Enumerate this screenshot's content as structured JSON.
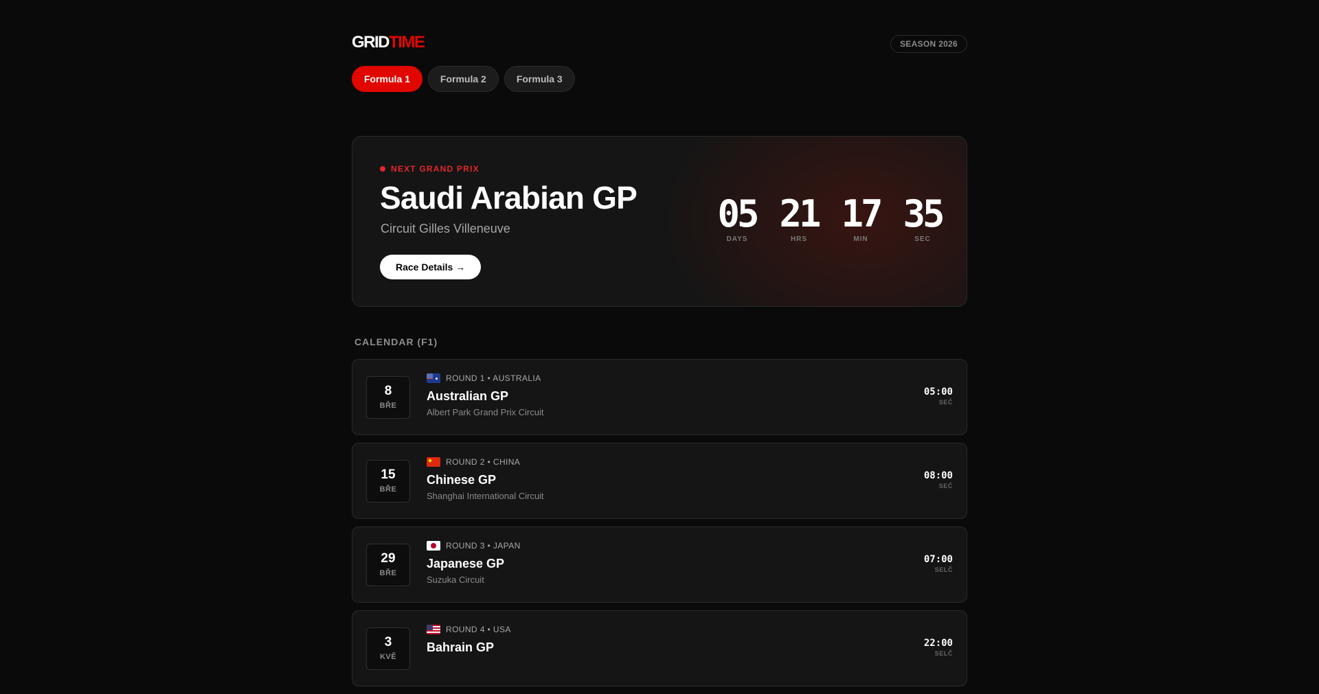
{
  "brand": {
    "part1": "GRID",
    "part2": "TIME",
    "accent": "#e10600"
  },
  "season_badge": "SEASON 2026",
  "tabs": [
    {
      "label": "Formula 1",
      "active": true
    },
    {
      "label": "Formula 2",
      "active": false
    },
    {
      "label": "Formula 3",
      "active": false
    }
  ],
  "hero": {
    "eyebrow": "NEXT GRAND PRIX",
    "race": "Saudi Arabian GP",
    "circuit": "Circuit Gilles Villeneuve",
    "button": "Race Details →",
    "countdown": [
      {
        "value": "05",
        "label": "DAYS"
      },
      {
        "value": "21",
        "label": "HRS"
      },
      {
        "value": "17",
        "label": "MIN"
      },
      {
        "value": "35",
        "label": "SEC"
      }
    ]
  },
  "calendar": {
    "title": "CALENDAR (F1)",
    "races": [
      {
        "day": "8",
        "month": "BŘE",
        "flag": "au-flag-icon",
        "meta": "ROUND 1 • AUSTRALIA",
        "name": "Australian GP",
        "circuit": "Albert Park Grand Prix Circuit",
        "time": "05:00",
        "tz": "SEČ"
      },
      {
        "day": "15",
        "month": "BŘE",
        "flag": "cn-flag-icon",
        "meta": "ROUND 2 • CHINA",
        "name": "Chinese GP",
        "circuit": "Shanghai International Circuit",
        "time": "08:00",
        "tz": "SEČ"
      },
      {
        "day": "29",
        "month": "BŘE",
        "flag": "jp-flag-icon",
        "meta": "ROUND 3 • JAPAN",
        "name": "Japanese GP",
        "circuit": "Suzuka Circuit",
        "time": "07:00",
        "tz": "SELČ"
      },
      {
        "day": "3",
        "month": "KVĚ",
        "flag": "us-flag-icon",
        "meta": "ROUND 4 • USA",
        "name": "Bahrain GP",
        "circuit": "",
        "time": "22:00",
        "tz": "SELČ"
      }
    ]
  }
}
